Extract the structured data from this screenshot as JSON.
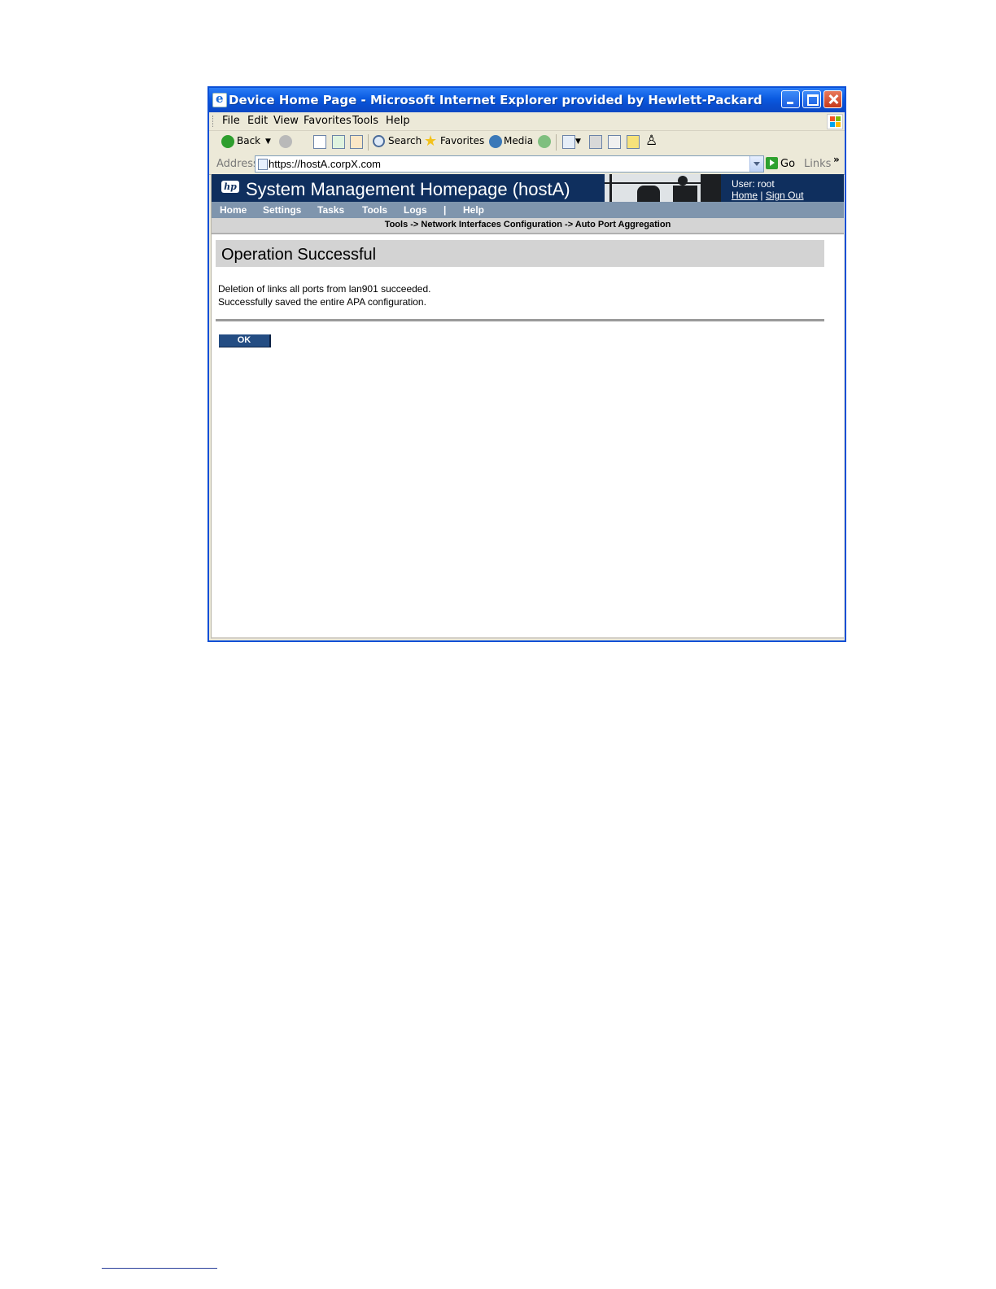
{
  "window": {
    "title": "Device Home Page - Microsoft Internet Explorer provided by Hewlett-Packard"
  },
  "menu": {
    "items": [
      "File",
      "Edit",
      "View",
      "Favorites",
      "Tools",
      "Help"
    ]
  },
  "toolbar": {
    "back_label": "Back",
    "search_label": "Search",
    "favorites_label": "Favorites",
    "media_label": "Media"
  },
  "address": {
    "label": "Address",
    "value": "https://hostA.corpX.com",
    "go_label": "Go",
    "links_label": "Links"
  },
  "smh": {
    "title": "System Management Homepage (hostA)",
    "user_label": "User: root",
    "home_link": "Home",
    "link_separator": "|",
    "signout_link": "Sign Out",
    "nav": [
      "Home",
      "Settings",
      "Tasks",
      "Tools",
      "Logs",
      "|",
      "Help"
    ],
    "breadcrumb": "Tools -> Network Interfaces Configuration -> Auto Port Aggregation"
  },
  "content": {
    "heading": "Operation Successful",
    "messages": [
      "Deletion of links all ports from lan901 succeeded.",
      "Successfully saved the entire APA configuration."
    ],
    "ok_label": "OK"
  },
  "icons": [
    "ie-page-icon",
    "minimize-icon",
    "maximize-icon",
    "close-icon",
    "windows-logo-icon",
    "back-icon",
    "forward-icon",
    "stop-icon",
    "refresh-icon",
    "home-icon",
    "search-icon",
    "favorites-star-icon",
    "media-icon",
    "history-icon",
    "mail-icon",
    "print-icon",
    "edit-icon",
    "discuss-icon",
    "messenger-icon",
    "go-arrow-icon",
    "hp-logo"
  ],
  "colors": {
    "title_bar": "#0a5ae0",
    "smh_header": "#0f2f5e",
    "nav_bar": "#7f95ad",
    "ok_button": "#244d83"
  }
}
